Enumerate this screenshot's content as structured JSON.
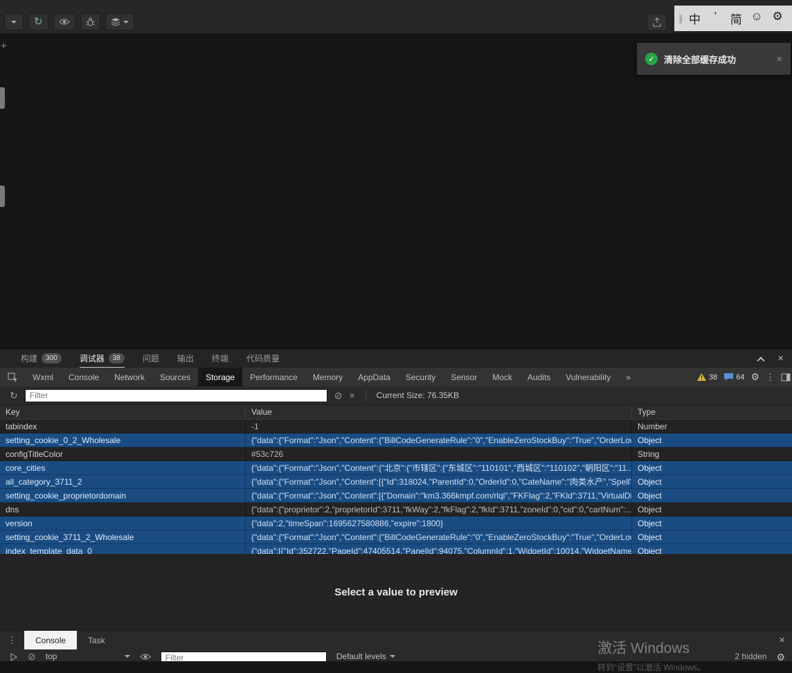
{
  "icons": {
    "refresh": "↻",
    "gear": "⚙",
    "smiley": "☺",
    "block": "⊘",
    "close": "×",
    "check": "✓",
    "dots": "⋮",
    "chevron_double": "»",
    "caret": "▾",
    "plus": "+",
    "grip": "∥",
    "grip2": "∥"
  },
  "ime_bar": {
    "items": [
      "中",
      "’",
      "简",
      "☺",
      "⚙"
    ],
    "names": [
      "chinese-mode",
      "punctuation-mode",
      "simplified-mode",
      "emoji-picker",
      "ime-settings"
    ]
  },
  "toast": {
    "message": "清除全部缓存成功"
  },
  "panel_tabs": {
    "active": "调试器",
    "items": [
      {
        "label": "构建",
        "badge": "300"
      },
      {
        "label": "调试器",
        "badge": "38"
      },
      {
        "label": "问题",
        "badge": ""
      },
      {
        "label": "输出",
        "badge": ""
      },
      {
        "label": "终端",
        "badge": ""
      },
      {
        "label": "代码质量",
        "badge": ""
      }
    ]
  },
  "devtools": {
    "selected": "Storage",
    "tabs": [
      "Wxml",
      "Console",
      "Network",
      "Sources",
      "Storage",
      "Performance",
      "Memory",
      "AppData",
      "Security",
      "Sensor",
      "Mock",
      "Audits",
      "Vulnerability",
      "»"
    ],
    "warning_count": "38",
    "message_count": "64"
  },
  "storage": {
    "filter_placeholder": "Filter",
    "current_size_label": "Current Size: 76.35KB",
    "columns": [
      "Key",
      "Value",
      "Type"
    ],
    "rows": [
      {
        "key": "tabindex",
        "value": "-1",
        "type": "Number",
        "highlighted": false
      },
      {
        "key": "setting_cookie_0_2_Wholesale",
        "value": "{\"data\":{\"Format\":\"Json\",\"Content\":{\"BillCodeGenerateRule\":\"0\",\"EnableZeroStockBuy\":\"True\",\"OrderLow...",
        "type": "Object",
        "highlighted": true
      },
      {
        "key": "configTitleColor",
        "value": "#53c726",
        "type": "String",
        "highlighted": false
      },
      {
        "key": "core_cities",
        "value": "{\"data\":{\"Format\":\"Json\",\"Content\":{\"北京\":{\"市辖区\":{\"东城区\":\"110101\",\"西城区\":\"110102\",\"朝阳区\":\"11...",
        "type": "Object",
        "highlighted": true
      },
      {
        "key": "all_category_3711_2",
        "value": "{\"data\":{\"Format\":\"Json\",\"Content\":[{\"Id\":318024,\"ParentId\":0,\"OrderId\":0,\"CateName\":\"肉类水产\",\"Spell\":...",
        "type": "Object",
        "highlighted": true
      },
      {
        "key": "setting_cookie_proprietordomain",
        "value": "{\"data\":{\"Format\":\"Json\",\"Content\":[{\"Domain\":\"km3.366kmpf.com/rlql\",\"FKFlag\":2,\"FKId\":3711,\"VirtualDi...",
        "type": "Object",
        "highlighted": true
      },
      {
        "key": "dns",
        "value": "{\"data\":{\"proprietor\":2,\"proprietorId\":3711,\"fkWay\":2,\"fkFlag\":2,\"fkId\":3711,\"zoneId\":0,\"cid\":0,\"cartNum\":...",
        "type": "Object",
        "highlighted": false
      },
      {
        "key": "version",
        "value": "{\"data\":2,\"timeSpan\":1695627580886,\"expire\":1800}",
        "type": "Object",
        "highlighted": true
      },
      {
        "key": "setting_cookie_3711_2_Wholesale",
        "value": "{\"data\":{\"Format\":\"Json\",\"Content\":{\"BillCodeGenerateRule\":\"0\",\"EnableZeroStockBuy\":\"True\",\"OrderLow...",
        "type": "Object",
        "highlighted": true
      },
      {
        "key": "index_template_data_0",
        "value": "{\"data\":[{\"Id\":352722,\"PageId\":47405514,\"PanelId\":94075,\"ColumnId\":1,\"WidgetId\":10014,\"WidgetName...",
        "type": "Object",
        "highlighted": true
      }
    ]
  },
  "preview": {
    "placeholder": "Select a value to preview"
  },
  "console_panel": {
    "tabs": [
      "Console",
      "Task"
    ],
    "selected": "Console",
    "context_selector": "top",
    "filter_placeholder": "Filter",
    "levels_label": "Default levels",
    "hidden_label": "2 hidden"
  },
  "watermark": {
    "title": "激活 Windows",
    "subtitle": "转到“设置”以激活 Windows。"
  }
}
